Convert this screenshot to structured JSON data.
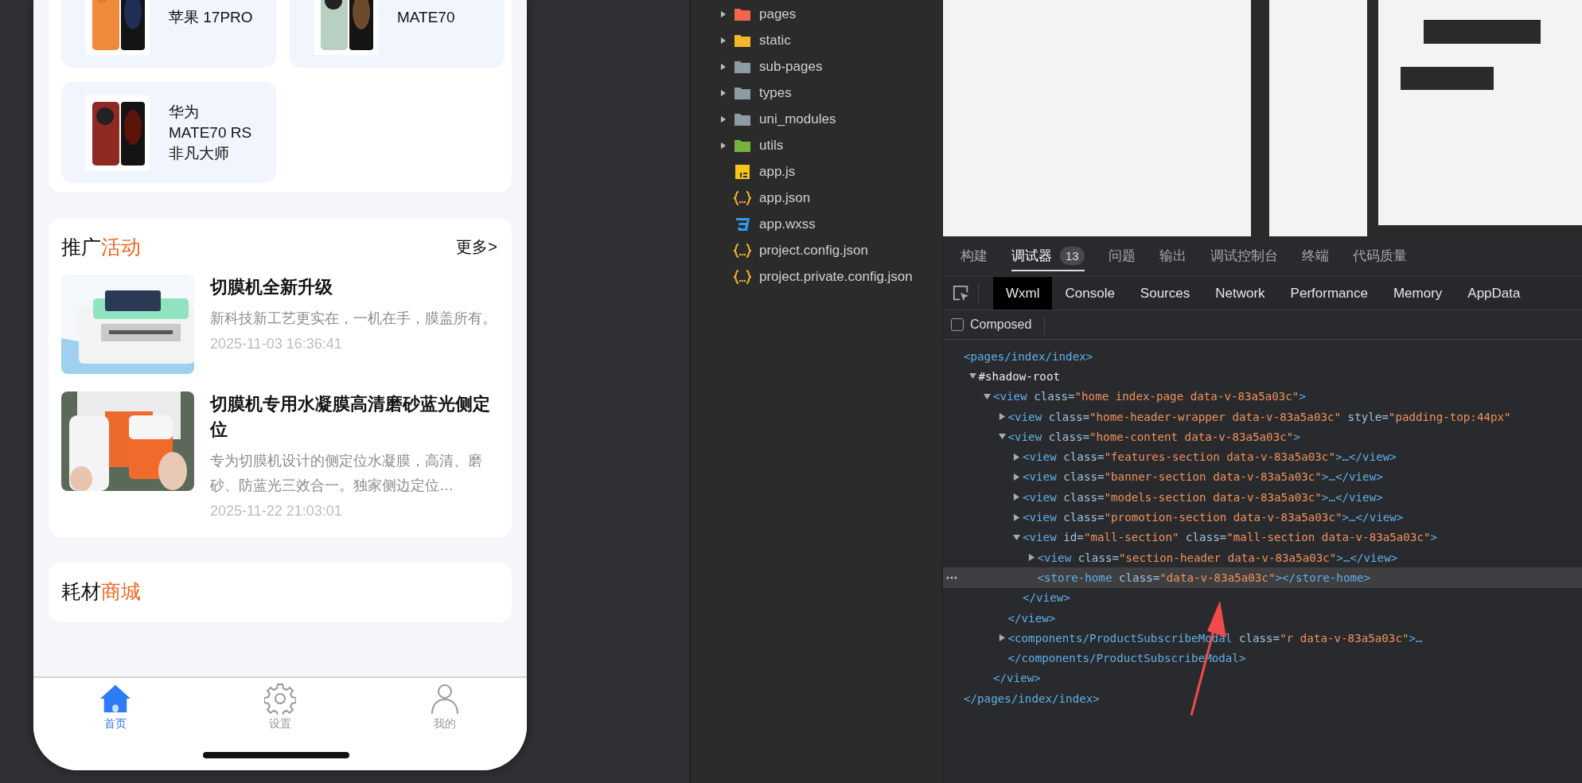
{
  "phone": {
    "models": [
      {
        "lines": [
          "苹果 17PRO"
        ]
      },
      {
        "lines": [
          "MATE70"
        ]
      },
      {
        "lines": [
          "华为",
          "MATE70 RS",
          "非凡大师"
        ]
      }
    ],
    "promotion": {
      "title": {
        "plain": "推广",
        "accent": "活动"
      },
      "more": "更多>",
      "items": [
        {
          "title": "切膜机全新升级",
          "desc": "新科技新工艺更实在，一机在手，膜盖所有。",
          "date": "2025-11-03 16:36:41"
        },
        {
          "title": "切膜机专用水凝膜高清磨砂蓝光侧定位",
          "desc": "专为切膜机设计的侧定位水凝膜，高清、磨砂、防蓝光三效合一。独家侧边定位…",
          "date": "2025-11-22 21:03:01"
        }
      ]
    },
    "mall": {
      "title": {
        "plain": "耗材",
        "accent": "商城"
      }
    },
    "tabbar": [
      {
        "kind": "home",
        "label": "首页",
        "selected": true
      },
      {
        "kind": "gear",
        "label": "设置",
        "selected": false
      },
      {
        "kind": "person",
        "label": "我的",
        "selected": false
      }
    ]
  },
  "file_tree": [
    {
      "kind": "folder",
      "name": "pages",
      "color": "#f0674b",
      "expanded": false
    },
    {
      "kind": "folder",
      "name": "static",
      "color": "#f5b629",
      "expanded": false
    },
    {
      "kind": "folder",
      "name": "sub-pages",
      "color": "#8d9ba5",
      "expanded": false
    },
    {
      "kind": "folder",
      "name": "types",
      "color": "#8d9ba5",
      "expanded": false
    },
    {
      "kind": "folder",
      "name": "uni_modules",
      "color": "#8d9ba5",
      "expanded": false
    },
    {
      "kind": "folder",
      "name": "utils",
      "color": "#74b33f",
      "expanded": false
    },
    {
      "kind": "js",
      "name": "app.js"
    },
    {
      "kind": "json",
      "name": "app.json"
    },
    {
      "kind": "css",
      "name": "app.wxss"
    },
    {
      "kind": "json",
      "name": "project.config.json"
    },
    {
      "kind": "json",
      "name": "project.private.config.json"
    }
  ],
  "panel_tabs": [
    {
      "label": "构建",
      "selected": false
    },
    {
      "label": "调试器",
      "selected": true,
      "badge": "13"
    },
    {
      "label": "问题",
      "selected": false
    },
    {
      "label": "输出",
      "selected": false
    },
    {
      "label": "调试控制台",
      "selected": false
    },
    {
      "label": "终端",
      "selected": false
    },
    {
      "label": "代码质量",
      "selected": false
    }
  ],
  "devtools_tabs": [
    {
      "label": "Wxml",
      "selected": true
    },
    {
      "label": "Console",
      "selected": false
    },
    {
      "label": "Sources",
      "selected": false
    },
    {
      "label": "Network",
      "selected": false
    },
    {
      "label": "Performance",
      "selected": false
    },
    {
      "label": "Memory",
      "selected": false
    },
    {
      "label": "AppData",
      "selected": false
    }
  ],
  "composed": {
    "label": "Composed",
    "checked": false
  },
  "dom": [
    {
      "kind": "element",
      "line": "<pages/index/index>",
      "selected": false,
      "close": "</pages/index/index>",
      "children": [
        {
          "kind": "text",
          "line": "#shadow-root",
          "expanded": true,
          "selected": false,
          "children": [
            {
              "kind": "element",
              "line": "<view class=\"home index-page data-v-83a5a03c\">",
              "expanded": true,
              "selected": false,
              "close": "</view>",
              "children": [
                {
                  "kind": "element",
                  "line": "<view class=\"home-header-wrapper data-v-83a5a03c\" style=\"padding-top:44px\"",
                  "expanded": false,
                  "selected": false
                },
                {
                  "kind": "element",
                  "line": "<view class=\"home-content data-v-83a5a03c\">",
                  "expanded": true,
                  "selected": false,
                  "close": "</view>",
                  "children": [
                    {
                      "kind": "element",
                      "line": "<view class=\"features-section data-v-83a5a03c\">…</view>",
                      "expanded": false,
                      "selected": false
                    },
                    {
                      "kind": "element",
                      "line": "<view class=\"banner-section data-v-83a5a03c\">…</view>",
                      "expanded": false,
                      "selected": false
                    },
                    {
                      "kind": "element",
                      "line": "<view class=\"models-section data-v-83a5a03c\">…</view>",
                      "expanded": false,
                      "selected": false
                    },
                    {
                      "kind": "element",
                      "line": "<view class=\"promotion-section data-v-83a5a03c\">…</view>",
                      "expanded": false,
                      "selected": false
                    },
                    {
                      "kind": "element",
                      "line": "<view id=\"mall-section\" class=\"mall-section data-v-83a5a03c\">",
                      "expanded": true,
                      "selected": false,
                      "close": "</view>",
                      "children": [
                        {
                          "kind": "element",
                          "line": "<view class=\"section-header data-v-83a5a03c\">…</view>",
                          "expanded": false,
                          "selected": false
                        },
                        {
                          "kind": "element",
                          "line": "<store-home class=\"data-v-83a5a03c\"></store-home>",
                          "selected": true
                        }
                      ]
                    }
                  ]
                },
                {
                  "kind": "element",
                  "line": "<components/ProductSubscribeModal class=\"r data-v-83a5a03c\">…",
                  "expanded": false,
                  "selected": false,
                  "close": "</components/ProductSubscribeModal>"
                }
              ]
            }
          ]
        }
      ]
    }
  ]
}
